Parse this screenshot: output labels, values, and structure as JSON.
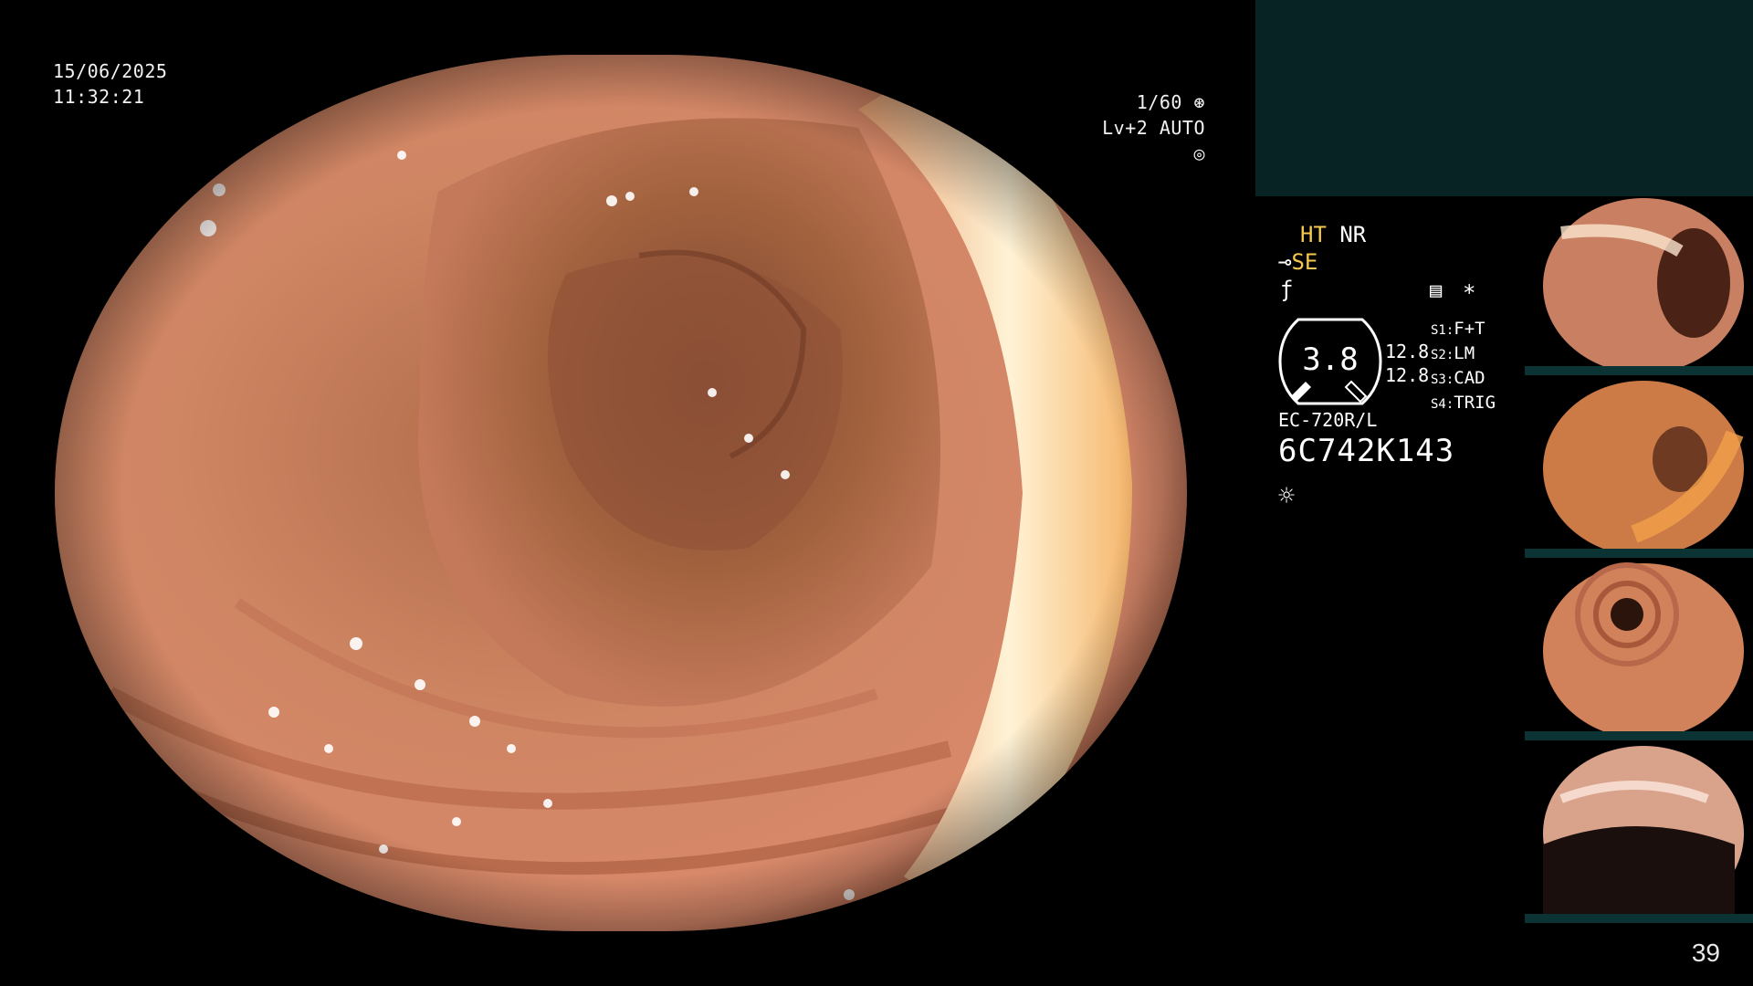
{
  "overlay": {
    "date": "15/06/2025",
    "time": "11:32:21",
    "shutter": "1/60",
    "iris": "Lv+2 AUTO"
  },
  "panel": {
    "ht": "HT",
    "nr": "NR",
    "se": "SE",
    "zoom": "3.8",
    "scope_value_1": "12.8",
    "scope_value_2": "12.8",
    "s_settings": [
      {
        "key": "S1:",
        "value": "F+T"
      },
      {
        "key": "S2:",
        "value": "LM"
      },
      {
        "key": "S3:",
        "value": "CAD"
      },
      {
        "key": "S4:",
        "value": "TRIG"
      }
    ],
    "scope_model": "EC-720R/L",
    "serial": "6C742K143"
  },
  "icons": {
    "shutter": "shutter-icon",
    "iris": "iris-icon",
    "se": "structure-enhancement-icon",
    "freeze": "freeze-icon",
    "memory": "memory-card-icon",
    "star": "asterisk-icon",
    "light": "light-icon"
  },
  "colors": {
    "background": "#000000",
    "highlight": "#f6c84c",
    "panel_box": "#072324",
    "text": "#ffffff"
  },
  "page_number": "39"
}
